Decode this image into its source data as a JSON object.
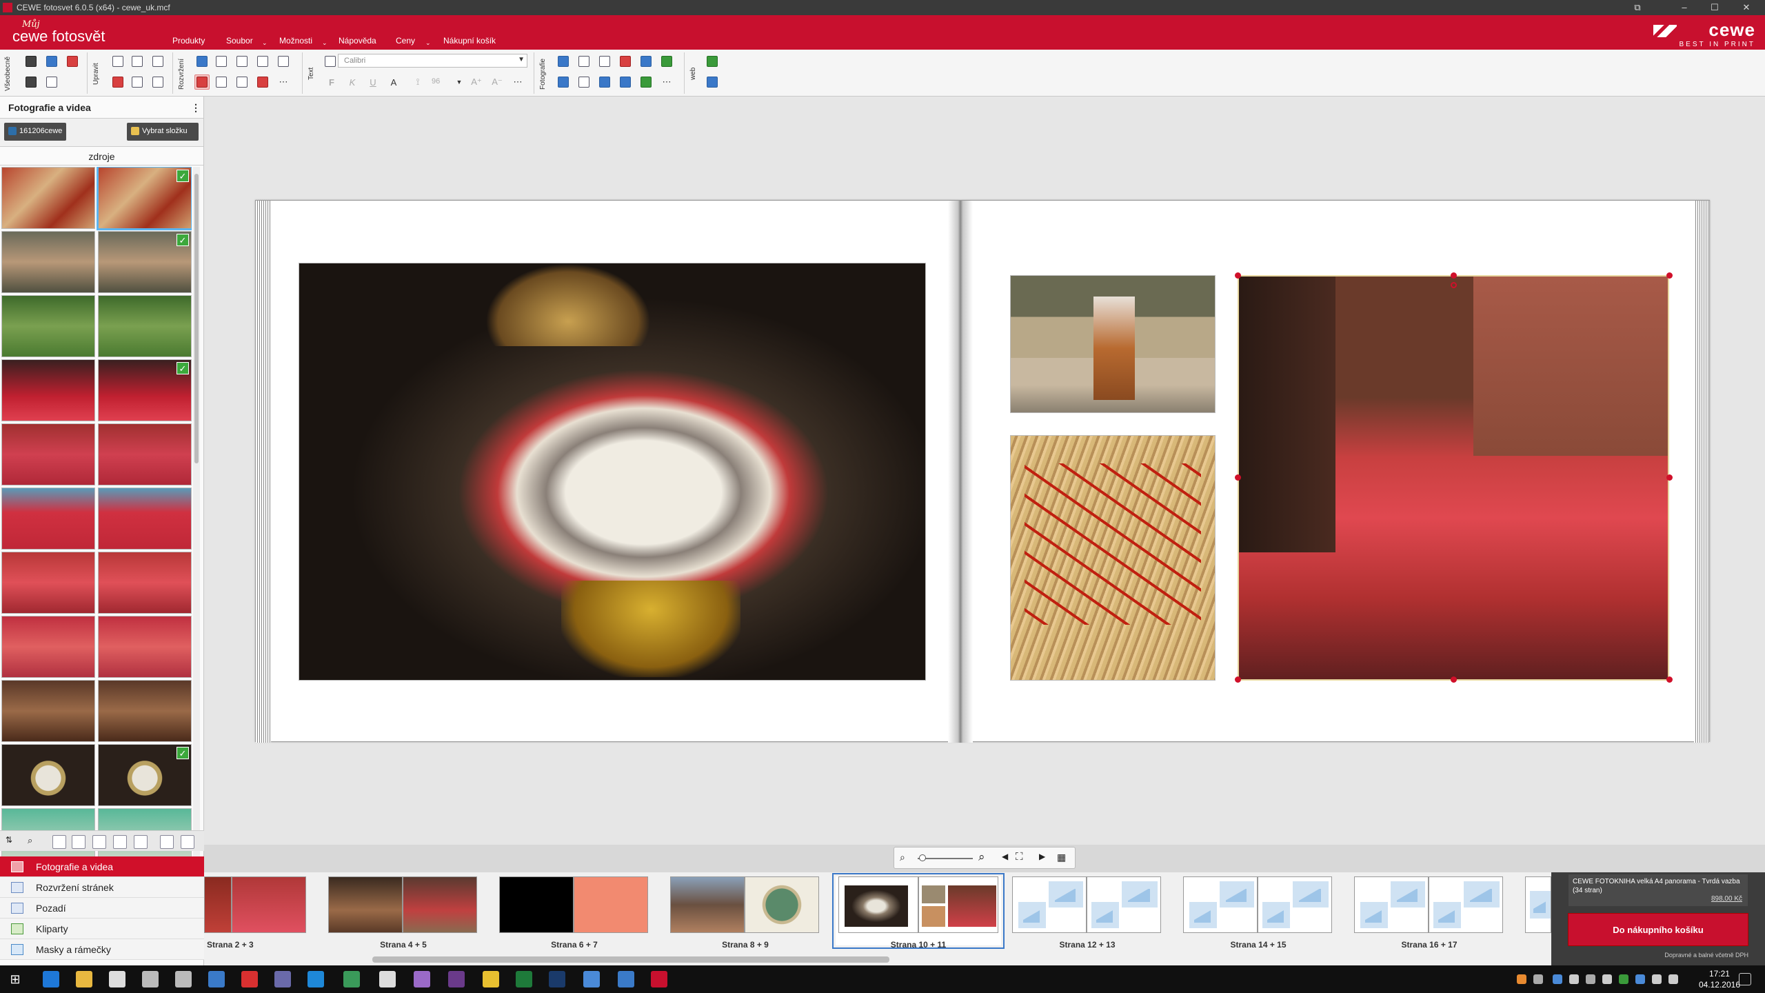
{
  "window": {
    "title": "CEWE fotosvet 6.0.5 (x64) - cewe_uk.mcf"
  },
  "logo": {
    "small": "Můj",
    "big": "cewe fotosvět"
  },
  "brand": {
    "name": "cewe",
    "tagline": "BEST IN PRINT"
  },
  "menu": [
    "Produkty",
    "Soubor",
    "Možnosti",
    "Nápověda",
    "Ceny",
    "Nákupní košík"
  ],
  "toolbar": {
    "groups": [
      "Všeobecně",
      "Upravit",
      "Rozvržení",
      "Text",
      "Fotografie",
      "web"
    ],
    "font": "Calibri",
    "font_size": "96"
  },
  "leftpanel": {
    "title": "Fotografie a videa",
    "folder_button": "161206cewe",
    "choose_folder_button": "Vybrat složku",
    "sources_label": "zdroje"
  },
  "nav": [
    "Fotografie a videa",
    "Rozvržení stránek",
    "Pozadí",
    "Kliparty",
    "Masky a rámečky"
  ],
  "pages": [
    "Strana 2 + 3",
    "Strana 4 + 5",
    "Strana 6 + 7",
    "Strana 8 + 9",
    "Strana 10 + 11",
    "Strana 12 + 13",
    "Strana 14 + 15",
    "Strana 16 + 17"
  ],
  "cart": {
    "product": "CEWE FOTOKNIHA velká A4 panorama - Tvrdá vazba  (34 stran)",
    "price": "898,00 Kč",
    "button": "Do nákupního košíku",
    "note": "Dopravné a balné včetně DPH"
  },
  "clock": {
    "time": "17:21",
    "date": "04.12.2016"
  },
  "colors": {
    "accent": "#c8102e",
    "selection": "#3a78c8"
  }
}
